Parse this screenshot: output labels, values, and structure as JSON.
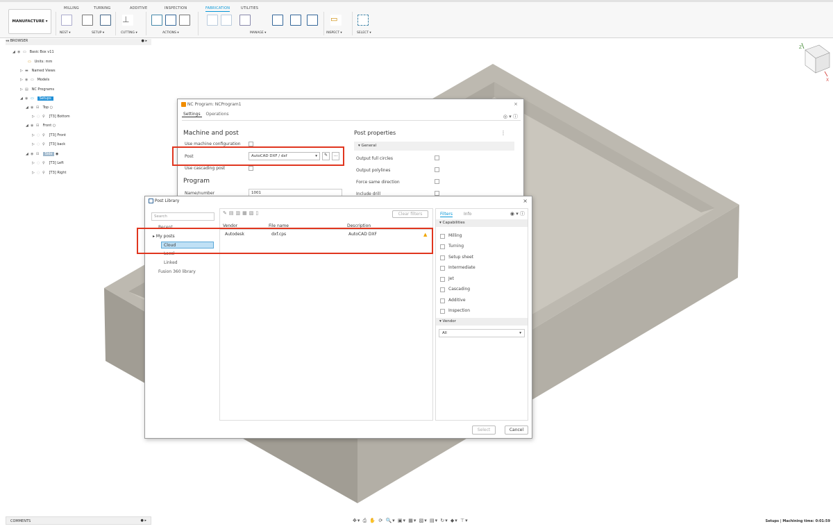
{
  "window": {
    "title": "Basic Box v11"
  },
  "workspace_tabs": [
    "MILLING",
    "TURNING",
    "ADDITIVE",
    "INSPECTION",
    "FABRICATION",
    "UTILITIES"
  ],
  "active_tab": "FABRICATION",
  "toolbar": {
    "manufacture_label": "MANUFACTURE ▾",
    "groups": [
      "NEST ▾",
      "SETUP ▾",
      "CUTTING ▾",
      "ACTIONS ▾",
      "MANAGE ▾",
      "INSPECT ▾",
      "SELECT ▾"
    ]
  },
  "browser": {
    "header": "BROWSER",
    "items": [
      {
        "label": "Basic Box v11"
      },
      {
        "label": "Units: mm"
      },
      {
        "label": "Named Views"
      },
      {
        "label": "Models"
      },
      {
        "label": "NC Programs"
      },
      {
        "label": "Setups"
      },
      {
        "label": "Top"
      },
      {
        "label": "[T3] Bottom"
      },
      {
        "label": "Front"
      },
      {
        "label": "[T3] Front"
      },
      {
        "label": "[T3] back"
      },
      {
        "label": "Side"
      },
      {
        "label": "[T3] Left"
      },
      {
        "label": "[T3] Right"
      }
    ]
  },
  "nc_dialog": {
    "title": "NC Program: NCProgram1",
    "tabs": [
      "Settings",
      "Operations"
    ],
    "machine_section": "Machine and post",
    "use_machine_config": "Use machine configuration",
    "post_label": "Post",
    "post_value": "AutoCAD DXF / dxf",
    "use_cascading": "Use cascading post",
    "program_section": "Program",
    "name_label": "Name/number",
    "name_value": "1001",
    "post_props_title": "Post properties",
    "general": "General",
    "props": [
      "Output full circles",
      "Output polylines",
      "Force same direction",
      "Include drill"
    ]
  },
  "post_library": {
    "title": "Post Library",
    "search_placeholder": "Search",
    "nav": [
      "Recent",
      "My posts",
      "Cloud",
      "Local",
      "Linked",
      "Fusion 360 library"
    ],
    "clear_filters": "Clear filters",
    "columns": [
      "Vendor",
      "File name",
      "Description"
    ],
    "rows": [
      {
        "vendor": "Autodesk",
        "file": "dxf.cps",
        "description": "AutoCAD DXF"
      }
    ],
    "filter_tabs": [
      "Filters",
      "Info"
    ],
    "capabilities_header": "Capabilities",
    "capabilities": [
      "Milling",
      "Turning",
      "Setup sheet",
      "Intermediate",
      "Jet",
      "Cascading",
      "Additive",
      "Inspection"
    ],
    "vendor_header": "Vendor",
    "vendor_value": "All",
    "select_button": "Select",
    "cancel_button": "Cancel"
  },
  "comments": "COMMENTS",
  "status": "Setups | Machining time: 0:01:59",
  "colors": {
    "accent": "#0696d7",
    "highlight": "#e0351e",
    "box_top": "#c2beb5",
    "box_side": "#a8a49c"
  }
}
